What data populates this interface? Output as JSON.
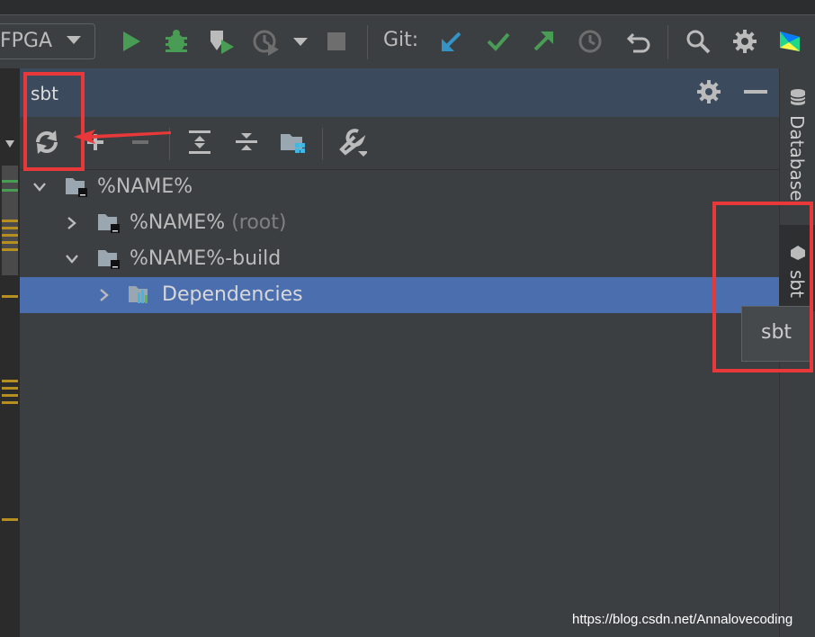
{
  "toolbar": {
    "run_config": "FPGA",
    "git_label": "Git:",
    "icons": [
      "run-icon",
      "debug-icon",
      "coverage-icon",
      "profile-icon",
      "dropdown-icon",
      "stop-icon",
      "git-update-icon",
      "git-commit-icon",
      "git-push-icon",
      "history-icon",
      "rollback-icon",
      "search-icon",
      "settings-icon",
      "toolbox-icon"
    ]
  },
  "tool_window": {
    "title": "sbt",
    "toolbar_icons": [
      "refresh-icon",
      "add-icon",
      "remove-icon",
      "expand-all-icon",
      "collapse-all-icon",
      "project-folder-icon",
      "wrench-icon"
    ]
  },
  "tree": {
    "nodes": [
      {
        "label": "%NAME%",
        "suffix": "",
        "expanded": true
      },
      {
        "label": "%NAME%",
        "suffix": "(root)",
        "expanded": false
      },
      {
        "label": "%NAME%-build",
        "suffix": "",
        "expanded": true
      },
      {
        "label": "Dependencies",
        "suffix": "",
        "expanded": false,
        "selected": true
      }
    ]
  },
  "right_stripe": {
    "database_label": "Database",
    "sbt_label": "sbt",
    "tooltip": "sbt"
  },
  "watermark": "https://blog.csdn.net/Annalovecoding",
  "colors": {
    "selection": "#4b6eaf",
    "header": "#3c4a5e",
    "annotation": "#e8383a",
    "run_green": "#499c54",
    "git_blue": "#3592c4"
  }
}
